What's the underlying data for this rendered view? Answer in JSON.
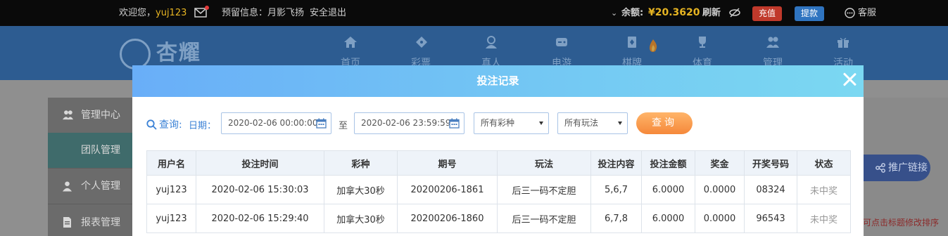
{
  "topbar": {
    "welcome": "欢迎您，",
    "username": "yuj123",
    "reserved_label": "预留信息：",
    "reserved_value": "月影飞扬",
    "logout": "安全退出",
    "balance_label": "余额:",
    "balance_value": "¥20.3620",
    "refresh": "刷新",
    "deposit": "充值",
    "withdraw": "提款",
    "service": "客服",
    "colors": {
      "deposit": "#c0392b",
      "withdraw": "#2f74c0",
      "money": "#e6b422"
    }
  },
  "logo": {
    "text": "杏耀"
  },
  "nav": [
    {
      "label": "首页",
      "icon": "home-icon"
    },
    {
      "label": "彩票",
      "icon": "ticket-icon"
    },
    {
      "label": "真人",
      "icon": "person-icon"
    },
    {
      "label": "电游",
      "icon": "gamepad-icon"
    },
    {
      "label": "棋牌",
      "icon": "cards-icon"
    },
    {
      "label": "体育",
      "icon": "trophy-icon"
    },
    {
      "label": "管理",
      "icon": "people-icon"
    },
    {
      "label": "活动",
      "icon": "gift-icon"
    }
  ],
  "sidebar": [
    {
      "label": "管理中心",
      "icon": "people-icon"
    },
    {
      "label": "团队管理",
      "icon": ""
    },
    {
      "label": "个人管理",
      "icon": "person-icon"
    },
    {
      "label": "报表管理",
      "icon": "report-icon"
    }
  ],
  "promo_button": "推广链接",
  "sort_hint": "可点击标题修改排序",
  "modal": {
    "title": "投注记录",
    "query_label": "查询:",
    "date_label": "日期：",
    "date_from": "2020-02-06 00:00:00",
    "to_label": "至",
    "date_to": "2020-02-06 23:59:59",
    "lottery_select": "所有彩种",
    "play_select": "所有玩法",
    "query_button": "查询"
  },
  "table": {
    "columns": [
      "用户名",
      "投注时间",
      "彩种",
      "期号",
      "玩法",
      "投注内容",
      "投注金额",
      "奖金",
      "开奖号码",
      "状态"
    ],
    "rows": [
      [
        "yuj123",
        "2020-02-06 15:30:03",
        "加拿大30秒",
        "20200206-1861",
        "后三一码不定胆",
        "5,6,7",
        "6.0000",
        "0.0000",
        "08324",
        "未中奖"
      ],
      [
        "yuj123",
        "2020-02-06 15:29:40",
        "加拿大30秒",
        "20200206-1860",
        "后三一码不定胆",
        "6,7,8",
        "6.0000",
        "0.0000",
        "96543",
        "未中奖"
      ]
    ]
  }
}
